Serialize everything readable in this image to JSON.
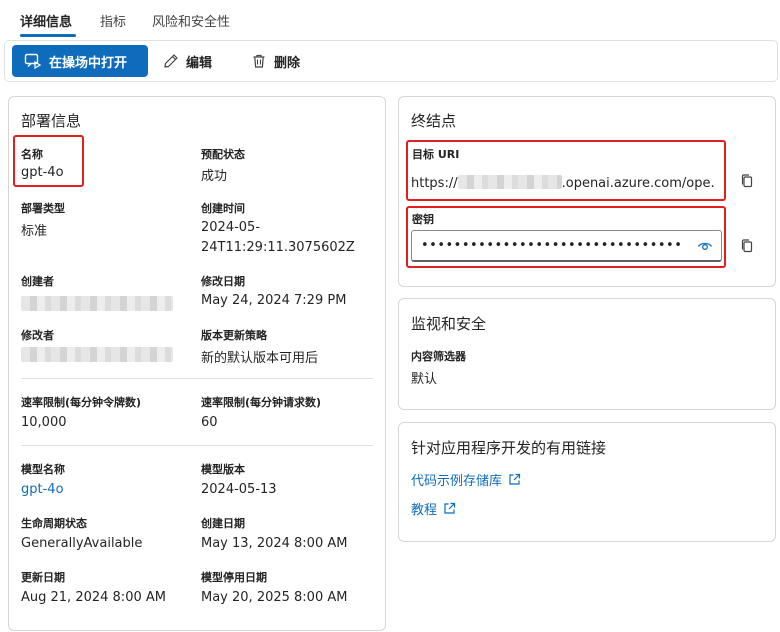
{
  "tabs": [
    {
      "label": "详细信息",
      "active": true
    },
    {
      "label": "指标",
      "active": false
    },
    {
      "label": "风险和安全性",
      "active": false
    }
  ],
  "toolbar": {
    "open_playground": "在操场中打开",
    "edit": "编辑",
    "delete": "删除"
  },
  "deployment": {
    "title": "部署信息",
    "name_label": "名称",
    "name_value": "gpt-4o",
    "provisioning_label": "预配状态",
    "provisioning_value": "成功",
    "type_label": "部署类型",
    "type_value": "标准",
    "created_label": "创建时间",
    "created_value_line1": "2024-05-",
    "created_value_line2": "24T11:29:11.3075602Z",
    "creator_label": "创建者",
    "modified_date_label": "修改日期",
    "modified_date_value": "May 24, 2024 7:29 PM",
    "modifier_label": "修改者",
    "update_policy_label": "版本更新策略",
    "update_policy_value": "新的默认版本可用后",
    "rate_tokens_label": "速率限制(每分钟令牌数)",
    "rate_tokens_value": "10,000",
    "rate_requests_label": "速率限制(每分钟请求数)",
    "rate_requests_value": "60",
    "model_name_label": "模型名称",
    "model_name_value": "gpt-4o",
    "model_version_label": "模型版本",
    "model_version_value": "2024-05-13",
    "lifecycle_label": "生命周期状态",
    "lifecycle_value": "GenerallyAvailable",
    "create_date_label": "创建日期",
    "create_date_value": "May 13, 2024 8:00 AM",
    "update_date_label": "更新日期",
    "update_date_value": "Aug 21, 2024 8:00 AM",
    "retire_date_label": "模型停用日期",
    "retire_date_value": "May 20, 2025 8:00 AM"
  },
  "endpoint": {
    "title": "终结点",
    "uri_label": "目标 URI",
    "uri_prefix": "https://",
    "uri_suffix": ".openai.azure.com/ope...",
    "key_label": "密钥",
    "key_value": "••••••••••••••••••••••••••••••••"
  },
  "monitoring": {
    "title": "监视和安全",
    "filter_label": "内容筛选器",
    "filter_value": "默认"
  },
  "links": {
    "title": "针对应用程序开发的有用链接",
    "code_samples": "代码示例存储库",
    "tutorial": "教程"
  },
  "colors": {
    "accent": "#0f6cbd",
    "highlight": "#e02020"
  }
}
